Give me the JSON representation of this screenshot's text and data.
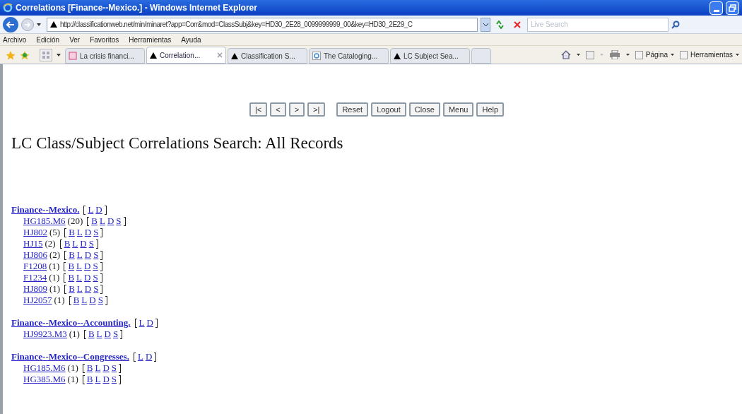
{
  "window": {
    "title": "Correlations [Finance--Mexico.] - Windows Internet Explorer"
  },
  "address": {
    "url": "http://classificationweb.net/min/minaret?app=Corr&mod=ClassSubj&key=HD30_2E28_0099999999_00&key=HD30_2E29_C"
  },
  "search": {
    "placeholder": "Live Search"
  },
  "menu": [
    "Archivo",
    "Edición",
    "Ver",
    "Favoritos",
    "Herramientas",
    "Ayuda"
  ],
  "tabs": [
    {
      "label": "La crisis financi...",
      "selected": false,
      "kind": "news"
    },
    {
      "label": "Correlation...",
      "selected": true,
      "kind": "site"
    },
    {
      "label": "Classification S...",
      "selected": false,
      "kind": "site"
    },
    {
      "label": "The Cataloging...",
      "selected": false,
      "kind": "ie"
    },
    {
      "label": "LC Subject Sea...",
      "selected": false,
      "kind": "site"
    }
  ],
  "command_bar": [
    "Página",
    "Herramientas"
  ],
  "nav_buttons": [
    "|<",
    "<",
    ">",
    ">|"
  ],
  "action_buttons": [
    "Reset",
    "Logout",
    "Close",
    "Menu",
    "Help"
  ],
  "heading": "LC Class/Subject Correlations Search: All Records",
  "results": [
    {
      "subject": "Finance--Mexico.",
      "links": [
        "L",
        "D"
      ],
      "entries": [
        {
          "code": "HG185.M6",
          "count": "(20)",
          "links": [
            "B",
            "L",
            "D",
            "S"
          ]
        },
        {
          "code": "HJ802",
          "count": "(5)",
          "links": [
            "B",
            "L",
            "D",
            "S"
          ]
        },
        {
          "code": "HJ15",
          "count": "(2)",
          "links": [
            "B",
            "L",
            "D",
            "S"
          ]
        },
        {
          "code": "HJ806",
          "count": "(2)",
          "links": [
            "B",
            "L",
            "D",
            "S"
          ]
        },
        {
          "code": "F1208",
          "count": "(1)",
          "links": [
            "B",
            "L",
            "D",
            "S"
          ]
        },
        {
          "code": "F1234",
          "count": "(1)",
          "links": [
            "B",
            "L",
            "D",
            "S"
          ]
        },
        {
          "code": "HJ809",
          "count": "(1)",
          "links": [
            "B",
            "L",
            "D",
            "S"
          ]
        },
        {
          "code": "HJ2057",
          "count": "(1)",
          "links": [
            "B",
            "L",
            "D",
            "S"
          ]
        }
      ]
    },
    {
      "subject": "Finance--Mexico--Accounting.",
      "links": [
        "L",
        "D"
      ],
      "entries": [
        {
          "code": "HJ9923.M3",
          "count": "(1)",
          "links": [
            "B",
            "L",
            "D",
            "S"
          ]
        }
      ]
    },
    {
      "subject": "Finance--Mexico--Congresses.",
      "links": [
        "L",
        "D"
      ],
      "entries": [
        {
          "code": "HG185.M6",
          "count": "(1)",
          "links": [
            "B",
            "L",
            "D",
            "S"
          ]
        },
        {
          "code": "HG385.M6",
          "count": "(1)",
          "links": [
            "B",
            "L",
            "D",
            "S"
          ]
        }
      ]
    }
  ]
}
